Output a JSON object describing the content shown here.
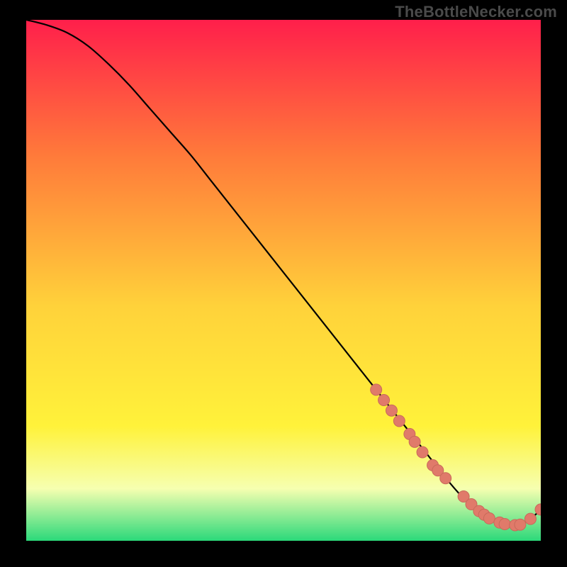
{
  "watermark": "TheBottleNecker.com",
  "colors": {
    "page_bg": "#000000",
    "gradient_top": "#ff1f4b",
    "gradient_mid1": "#ff7a3a",
    "gradient_mid2": "#ffd23a",
    "gradient_mid3": "#fff23a",
    "gradient_band_pale": "#f6ffb0",
    "gradient_bottom": "#2bd97a",
    "curve": "#000000",
    "marker_fill": "#e07a6a",
    "marker_stroke": "#c86a5a"
  },
  "chart_data": {
    "type": "line",
    "title": "",
    "xlabel": "",
    "ylabel": "",
    "xlim": [
      0,
      100
    ],
    "ylim": [
      0,
      100
    ],
    "series": [
      {
        "name": "curve",
        "x": [
          0,
          4,
          8,
          12,
          16,
          20,
          24,
          28,
          32,
          36,
          40,
          44,
          48,
          52,
          56,
          60,
          64,
          68,
          72,
          74,
          76,
          78,
          80,
          82,
          84,
          86,
          88,
          90,
          92,
          94,
          96,
          98,
          100
        ],
        "y": [
          100,
          99,
          97.5,
          95,
          91.5,
          87.5,
          83,
          78.5,
          74,
          69,
          64,
          59,
          54,
          49,
          44,
          39,
          34,
          29,
          24,
          21.5,
          19,
          16.5,
          14,
          11.5,
          9.2,
          7.2,
          5.6,
          4.3,
          3.4,
          3.0,
          3.2,
          4.2,
          6.0
        ]
      }
    ],
    "markers": {
      "x": [
        68,
        69.5,
        71,
        72.5,
        74.5,
        75.5,
        77,
        79,
        80,
        81.5,
        85,
        86.5,
        88,
        89,
        90,
        92,
        93,
        95,
        96,
        98,
        100
      ],
      "y": [
        29,
        27,
        25,
        23,
        20.5,
        19,
        17,
        14.5,
        13.5,
        12,
        8.5,
        7,
        5.7,
        5,
        4.3,
        3.5,
        3.2,
        3.0,
        3.1,
        4.2,
        6.0
      ]
    }
  }
}
